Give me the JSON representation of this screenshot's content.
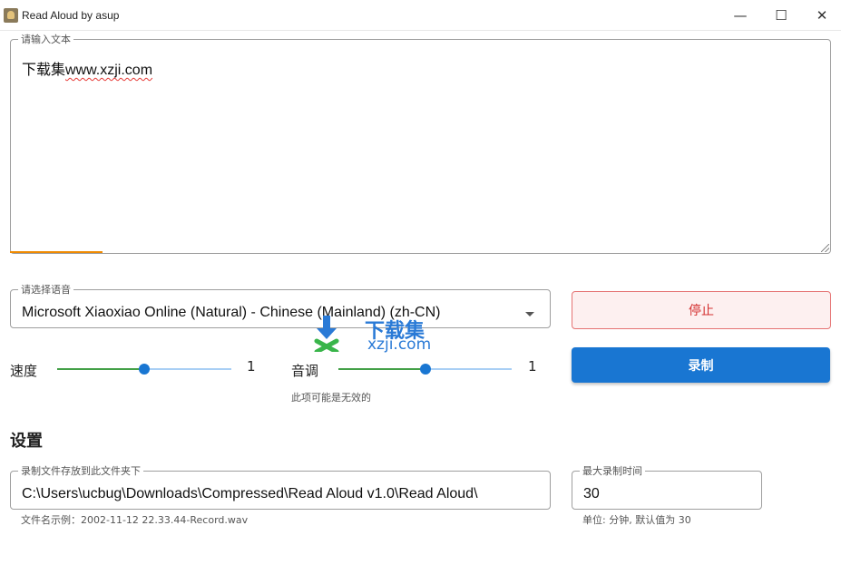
{
  "window": {
    "title": "Read Aloud by asup",
    "min_glyph": "—",
    "max_glyph": "☐",
    "close_glyph": "✕"
  },
  "text_input": {
    "legend": "请输入文本",
    "value_prefix": "下载集",
    "value_misspelled": "www.xzji.com"
  },
  "voice": {
    "legend": "请选择语音",
    "selected": "Microsoft Xiaoxiao Online (Natural) - Chinese (Mainland) (zh-CN)"
  },
  "buttons": {
    "stop": "停止",
    "record": "录制"
  },
  "speed": {
    "label": "速度",
    "value": "1",
    "position": 0.5
  },
  "pitch": {
    "label": "音调",
    "value": "1",
    "position": 0.5,
    "hint": "此项可能是无效的"
  },
  "settings": {
    "heading": "设置",
    "folder": {
      "legend": "录制文件存放到此文件夹下",
      "value": "C:\\Users\\ucbug\\Downloads\\Compressed\\Read Aloud v1.0\\Read Aloud\\",
      "hint": "文件名示例：2002-11-12 22.33.44-Record.wav"
    },
    "max_time": {
      "legend": "最大录制时间",
      "value": "30",
      "hint": "单位: 分钟, 默认值为 30"
    }
  },
  "watermark": {
    "title": "下载集",
    "domain": "xzji.com"
  },
  "colors": {
    "accent": "#1976d2",
    "slider_fill": "#43a047",
    "stop": "#d32f2f",
    "focus": "#f08a00"
  }
}
